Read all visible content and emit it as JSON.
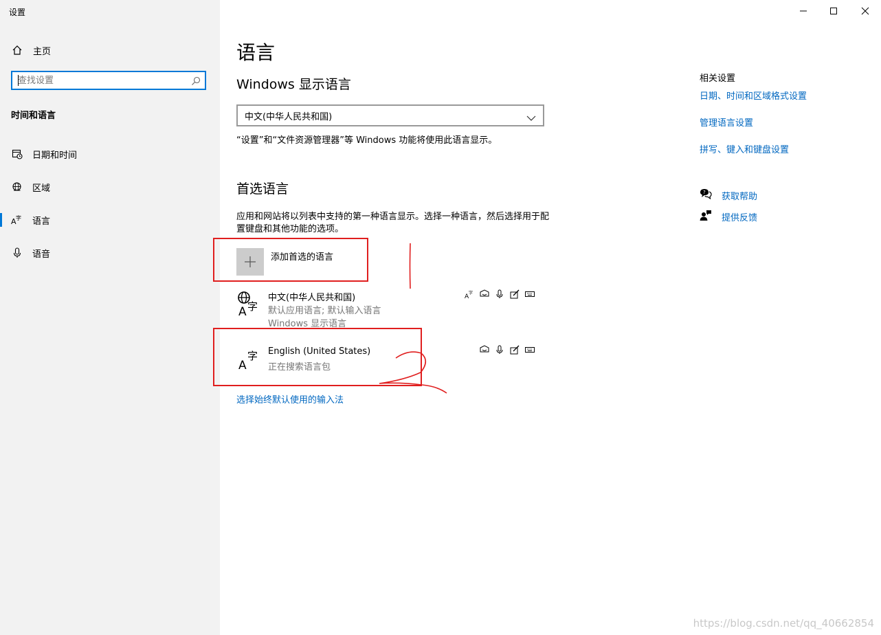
{
  "window": {
    "title": "设置",
    "minimize_icon": "minimize-icon",
    "maximize_icon": "maximize-icon",
    "close_icon": "close-icon"
  },
  "sidebar": {
    "home_label": "主页",
    "search_placeholder": "查找设置",
    "section_title": "时间和语言",
    "items": [
      {
        "label": "日期和时间",
        "icon": "calendar-clock-icon"
      },
      {
        "label": "区域",
        "icon": "globe-icon"
      },
      {
        "label": "语言",
        "icon": "language-icon",
        "active": true
      },
      {
        "label": "语音",
        "icon": "microphone-icon"
      }
    ]
  },
  "main": {
    "page_title": "语言",
    "display_language": {
      "heading": "Windows 显示语言",
      "selected": "中文(中华人民共和国)",
      "description": "“设置”和“文件资源管理器”等 Windows 功能将使用此语言显示。"
    },
    "preferred": {
      "heading": "首选语言",
      "description": "应用和网站将以列表中支持的第一种语言显示。选择一种语言，然后选择用于配置键盘和其他功能的选项。",
      "add_label": "添加首选的语言",
      "languages": [
        {
          "name": "中文(中华人民共和国)",
          "line1": "默认应用语言; 默认输入语言",
          "line2": "Windows 显示语言"
        },
        {
          "name": "English (United States)",
          "line1": "正在搜索语言包"
        }
      ]
    },
    "input_method_link": "选择始终默认使用的输入法"
  },
  "related": {
    "title": "相关设置",
    "links": [
      "日期、时间和区域格式设置",
      "管理语言设置",
      "拼写、键入和键盘设置"
    ],
    "help": "获取帮助",
    "feedback": "提供反馈"
  },
  "annotations": {
    "color": "#e01e1e",
    "marks": [
      "1",
      "2"
    ]
  },
  "watermark": "https://blog.csdn.net/qq_40662854"
}
